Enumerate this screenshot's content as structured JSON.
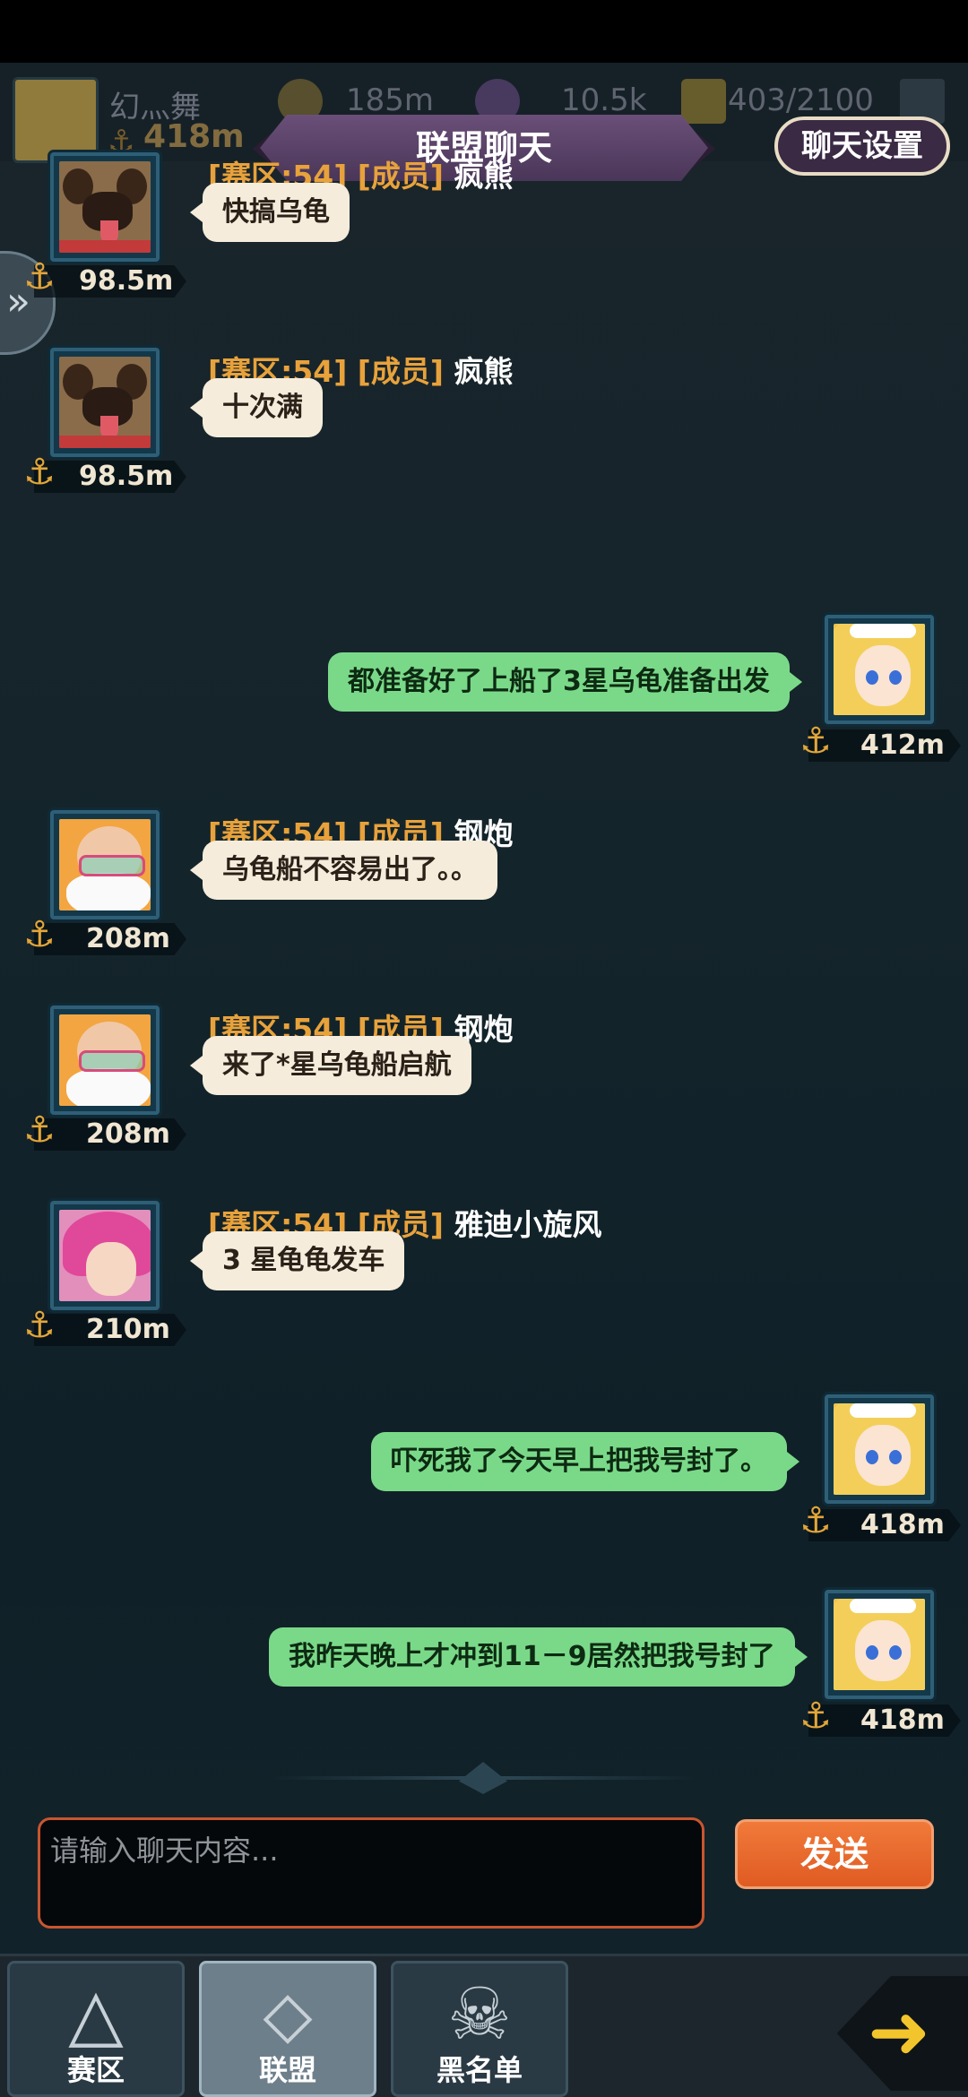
{
  "top_bar": {
    "player_name": "幻灬舞",
    "anchor_value": "418m",
    "coins": "185m",
    "gems": "10.5k",
    "energy": "403/2100"
  },
  "header": {
    "title": "联盟聊天",
    "settings_label": "聊天设置"
  },
  "messages": [
    {
      "side": "left",
      "tag": "[赛区:54] [成员]",
      "name": "疯熊",
      "text": "快搞乌龟",
      "distance": "98.5m",
      "avatar": "pug"
    },
    {
      "side": "left",
      "tag": "[赛区:54] [成员]",
      "name": "疯熊",
      "text": "十次满",
      "distance": "98.5m",
      "avatar": "pug"
    },
    {
      "side": "right",
      "text": "都准备好了上船了3星乌龟准备出发",
      "distance": "412m",
      "avatar": "blonde-girl"
    },
    {
      "side": "left",
      "tag": "[赛区:54] [成员]",
      "name": "钢炮",
      "text": "乌龟船不容易出了。。",
      "distance": "208m",
      "avatar": "old-man"
    },
    {
      "side": "left",
      "tag": "[赛区:54] [成员]",
      "name": "钢炮",
      "text": "来了*星乌龟船启航",
      "distance": "208m",
      "avatar": "old-man"
    },
    {
      "side": "left",
      "tag": "[赛区:54] [成员]",
      "name": "雅迪小旋风",
      "text": "3  星龟龟发车",
      "distance": "210m",
      "avatar": "pink-hair-girl"
    },
    {
      "side": "right",
      "text": "吓死我了今天早上把我号封了。",
      "distance": "418m",
      "avatar": "blonde-girl"
    },
    {
      "side": "right",
      "text": "我昨天晚上才冲到11－9居然把我号封了",
      "distance": "418m",
      "avatar": "blonde-girl"
    }
  ],
  "composer": {
    "placeholder": "请输入聊天内容...",
    "send_label": "发送"
  },
  "tabs": [
    {
      "label": "赛区",
      "active": false
    },
    {
      "label": "联盟",
      "active": true
    },
    {
      "label": "黑名单",
      "active": false
    }
  ],
  "colors": {
    "accent_tag": "#e8a23b",
    "self_bubble": "#7ad989",
    "other_bubble": "#f5ecdb",
    "send_button": "#e8672c"
  }
}
